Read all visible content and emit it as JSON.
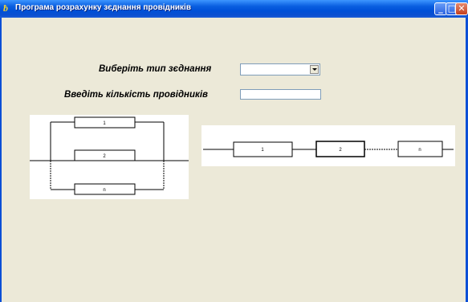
{
  "window": {
    "title": "Програма розрахунку зєднання провідників",
    "app_icon": "delphi-app-icon",
    "controls": [
      "minimize-icon",
      "maximize-icon",
      "close-icon"
    ],
    "minimize_glyph": "_",
    "maximize_glyph": "□",
    "close_glyph": "✕"
  },
  "form": {
    "connection_type_label": "Виберіть тип зєднання",
    "connection_type_value": "",
    "conductor_count_label": "Введіть кількість провідників",
    "conductor_count_value": ""
  },
  "diagrams": {
    "parallel": {
      "resistors": [
        "1",
        "2",
        "n"
      ]
    },
    "series": {
      "resistors": [
        "1",
        "2",
        "n"
      ]
    }
  }
}
